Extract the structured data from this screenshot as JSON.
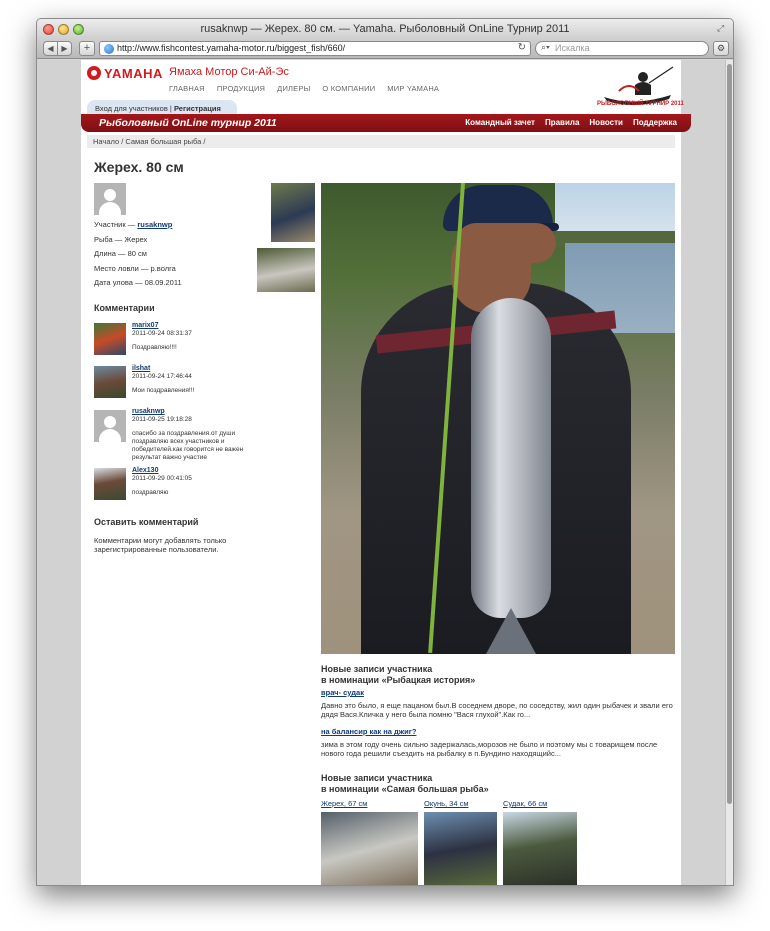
{
  "window": {
    "title": "rusaknwp — Жерех. 80 см. — Yamaha. Рыболовный OnLine Турнир 2011",
    "url": "http://www.fishcontest.yamaha-motor.ru/biggest_fish/660/",
    "search_placeholder": "Искалка"
  },
  "site": {
    "brand": "YAMAHA",
    "company": "Ямаха Мотор Си-Ай-Эс",
    "topnav": [
      "ГЛАВНАЯ",
      "ПРОДУКЦИЯ",
      "ДИЛЕРЫ",
      "О КОМПАНИИ",
      "МИР YAMAHA"
    ],
    "logo_caption": "РЫБОЛОВНЫЙ ТУРНИР 2011",
    "login_label": "Вход для участников",
    "register_label": "Регистрация",
    "tournament_title": "Рыболовный OnLine турнир 2011",
    "rednav": [
      "Командный зачет",
      "Правила",
      "Новости",
      "Поддержка"
    ],
    "breadcrumb": "Начало  /  Самая большая рыба  /"
  },
  "catch": {
    "title": "Жерех. 80 см",
    "participant_label": "Участник —",
    "participant": "rusaknwp",
    "fish": "Рыба — Жерех",
    "length": "Длина — 80 см",
    "place": "Место ловли — р.волга",
    "date": "Дата улова — 08.09.2011"
  },
  "comments": {
    "heading": "Комментарии",
    "items": [
      {
        "user": "marix07",
        "date": "2011-09-24 08:31:37",
        "text": "Поздравляю!!!!"
      },
      {
        "user": "ilshat",
        "date": "2011-09-24 17:46:44",
        "text": "Мои поздравления!!!"
      },
      {
        "user": "rusaknwp",
        "date": "2011-09-25 19:18:28",
        "text": "спасибо за поздравления.от души поздравляю всех участников и победителей.как говорится не важен результат важно участие"
      },
      {
        "user": "Alex130",
        "date": "2011-09-29 00:41:05",
        "text": "поздравляю"
      }
    ]
  },
  "leave_comment": {
    "heading": "Оставить комментарий",
    "note": "Комментарии могут добавлять только зарегистрированные пользователи."
  },
  "stories": {
    "heading_line1": "Новые записи участника",
    "heading_line2": "в номинации «Рыбацкая история»",
    "items": [
      {
        "title": "врач- судак",
        "text": "Давно это было, я еще пацаном был.В соседнем дворе, по соседству, жил один рыбачек и звали его дядя Вася.Кличка у него была помню \"Вася глухой\".Как го..."
      },
      {
        "title": "на балансир как на джиг?",
        "text": "зима в этом году очень сильно задержалась,морозов не было и поэтому мы с товарищем после нового года решили съездить на рыбалку в п.Бундино находящийс..."
      }
    ]
  },
  "biggest": {
    "heading_line1": "Новые записи участника",
    "heading_line2": "в номинации «Самая большая рыба»",
    "items": [
      "Жерех, 67 см",
      "Окунь, 34 см",
      "Судак, 66 см"
    ]
  }
}
